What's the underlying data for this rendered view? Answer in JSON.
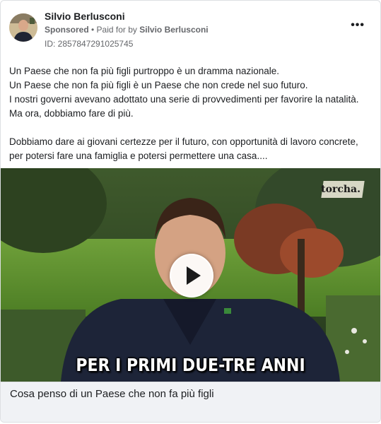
{
  "post": {
    "author": "Silvio Berlusconi",
    "sponsored": "Sponsored",
    "paid_for_prefix": " • Paid for by ",
    "paid_for_name": "Silvio Berlusconi",
    "ad_id": "ID: 2857847291025745",
    "more_label": "•••",
    "body_lines": [
      "Un Paese che non fa più figli purtroppo è un dramma nazionale.",
      "Un Paese che non fa più figli è un Paese che non crede nel suo futuro.",
      "I nostri governi avevano adottato una serie di provvedimenti per favorire la natalità.",
      "Ma ora, dobbiamo fare di più."
    ],
    "body_lines_2": [
      "Dobbiamo dare ai giovani certezze per il futuro, con opportunità di lavoro concrete,",
      "per potersi fare una famiglia e potersi permettere una casa...."
    ]
  },
  "video": {
    "logo": "torcha.",
    "subtitle": "PER I PRIMI DUE-TRE ANNI",
    "play_icon": "play-icon"
  },
  "caption": {
    "title": "Cosa penso di un Paese che non fa più figli"
  }
}
